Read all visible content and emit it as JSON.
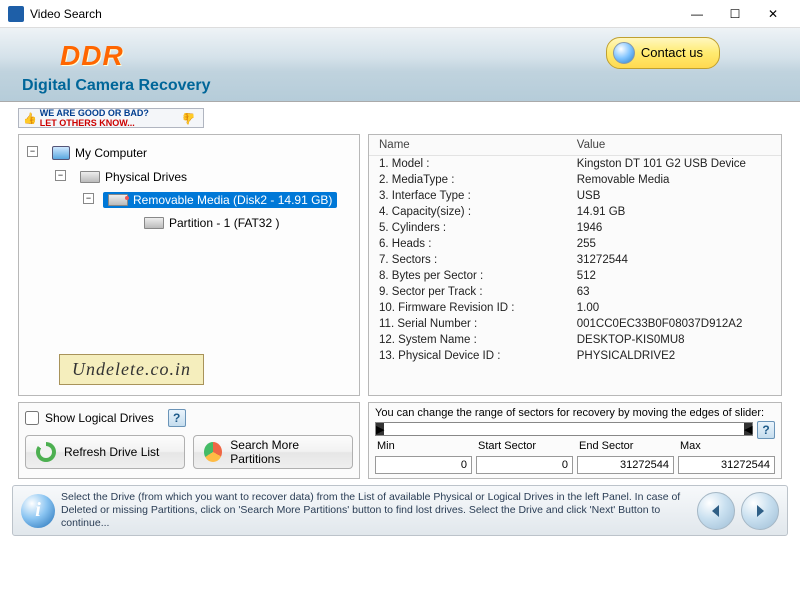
{
  "titlebar": {
    "title": "Video Search"
  },
  "header": {
    "logo": "DDR",
    "subtitle": "Digital Camera Recovery",
    "contact": "Contact us"
  },
  "feedback": {
    "line1": "WE ARE GOOD OR BAD?",
    "line2": "LET OTHERS KNOW..."
  },
  "tree": {
    "root": "My Computer",
    "level1": "Physical Drives",
    "selected": "Removable Media (Disk2 - 14.91 GB)",
    "partition": "Partition - 1 (FAT32 )"
  },
  "watermark": "Undelete.co.in",
  "props": {
    "col_name": "Name",
    "col_value": "Value",
    "rows": [
      {
        "n": "1. Model :",
        "v": "Kingston DT 101 G2 USB Device"
      },
      {
        "n": "2. MediaType :",
        "v": "Removable Media"
      },
      {
        "n": "3. Interface Type :",
        "v": "USB"
      },
      {
        "n": "4. Capacity(size) :",
        "v": "14.91 GB"
      },
      {
        "n": "5. Cylinders :",
        "v": "1946"
      },
      {
        "n": "6. Heads :",
        "v": "255"
      },
      {
        "n": "7. Sectors :",
        "v": "31272544"
      },
      {
        "n": "8. Bytes per Sector :",
        "v": "512"
      },
      {
        "n": "9. Sector per Track :",
        "v": "63"
      },
      {
        "n": "10. Firmware Revision ID :",
        "v": "1.00"
      },
      {
        "n": "11. Serial Number :",
        "v": "001CC0EC33B0F08037D912A2"
      },
      {
        "n": "12. System Name :",
        "v": "DESKTOP-KIS0MU8"
      },
      {
        "n": "13. Physical Device ID :",
        "v": "PHYSICALDRIVE2"
      }
    ]
  },
  "controls": {
    "show_logical": "Show Logical Drives",
    "refresh": "Refresh Drive List",
    "search_parts": "Search More Partitions"
  },
  "sector": {
    "hint": "You can change the range of sectors for recovery by moving the edges of slider:",
    "min_lbl": "Min",
    "start_lbl": "Start Sector",
    "end_lbl": "End Sector",
    "max_lbl": "Max",
    "min": "0",
    "start": "0",
    "end": "31272544",
    "max": "31272544"
  },
  "footer": {
    "text": "Select the Drive (from which you want to recover data) from the List of available Physical or Logical Drives in the left Panel. In case of Deleted or missing Partitions, click on 'Search More Partitions' button to find lost drives. Select the Drive and click 'Next' Button to continue..."
  }
}
